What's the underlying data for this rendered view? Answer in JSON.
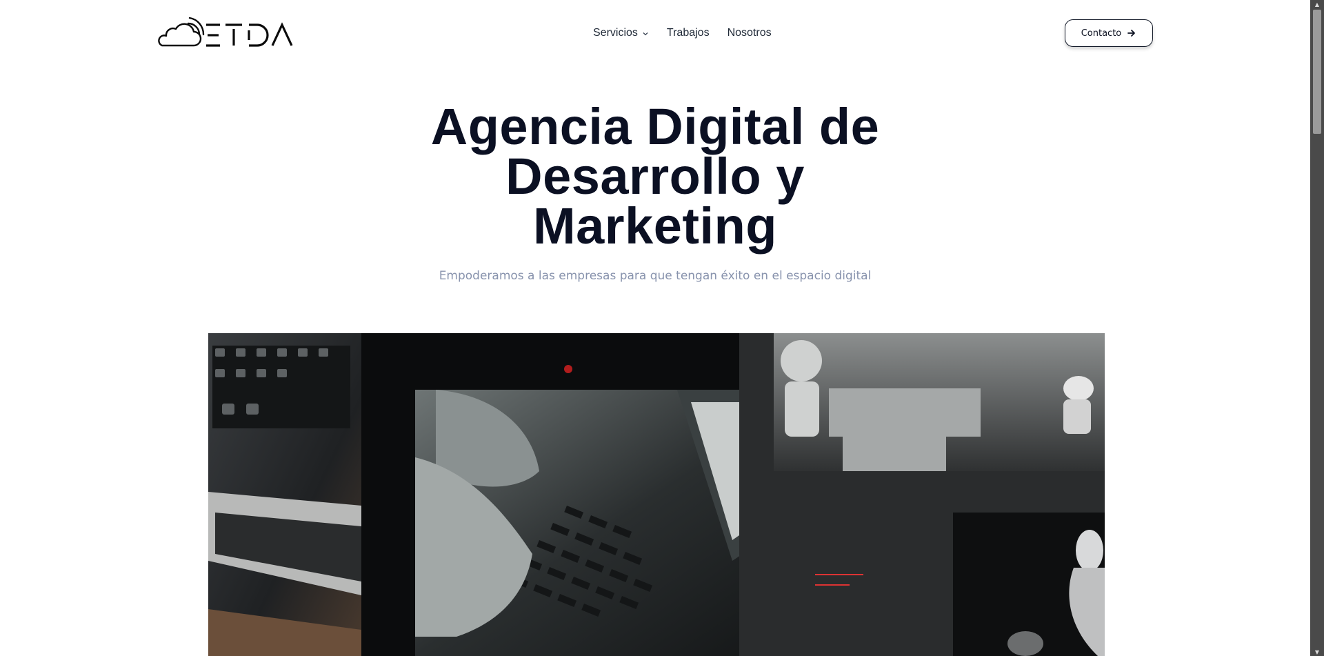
{
  "header": {
    "logo_text": "ETDA",
    "nav": [
      {
        "label": "Servicios",
        "has_dropdown": true
      },
      {
        "label": "Trabajos"
      },
      {
        "label": "Nosotros"
      }
    ],
    "contact_label": "Contacto"
  },
  "hero": {
    "title_lines": [
      "Agencia Digital de",
      "Desarrollo y",
      "Marketing"
    ],
    "subtitle": "Empoderamos a las empresas para que tengan éxito en el espacio digital"
  },
  "media": {
    "icon": "video-collage-image",
    "description_icons": [
      "laptop",
      "typing-hands-keyboard",
      "robots"
    ]
  },
  "colors": {
    "title": "#0b1023",
    "subtitle": "#8893ad",
    "nav_text": "#1f2937",
    "button_border": "#111827",
    "media_bg": "#0c0d0f"
  },
  "scrollbar": {
    "up_glyph": "▲",
    "down_glyph": "▼"
  }
}
